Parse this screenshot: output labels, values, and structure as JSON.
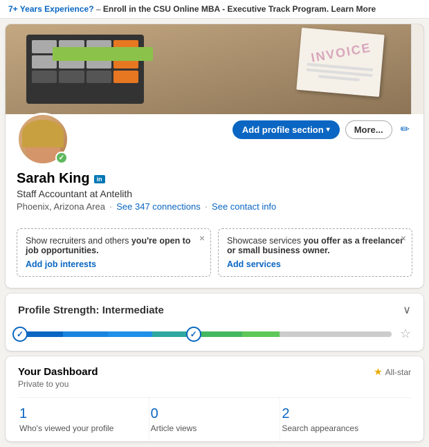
{
  "topBanner": {
    "highlight": "7+ Years Experience?",
    "dash": " – ",
    "boldText": "Enroll in the CSU Online MBA - Executive Track Program. Learn More"
  },
  "profile": {
    "name": "Sarah King",
    "linkedinBadge": "in",
    "title": "Staff Accountant at Antelith",
    "location": "Phoenix, Arizona Area",
    "connections": "See 347 connections",
    "contactInfo": "See contact info"
  },
  "actions": {
    "addSection": "Add profile section",
    "more": "More...",
    "editIcon": "✏"
  },
  "notifications": [
    {
      "id": "n1",
      "normalText": "Show recruiters and others ",
      "boldText": "you're open to job opportunities.",
      "linkText": "Add job interests"
    },
    {
      "id": "n2",
      "normalText": "Showcase services ",
      "boldText": "you offer as a freelancer or small business owner.",
      "linkText": "Add services"
    }
  ],
  "profileStrength": {
    "label": "Profile Strength:",
    "level": "Intermediate",
    "chevron": "∨"
  },
  "dashboard": {
    "title": "Your Dashboard",
    "subtitle": "Private to you",
    "allstarLabel": "All-star",
    "stats": [
      {
        "number": "1",
        "label": "Who's viewed your profile"
      },
      {
        "number": "0",
        "label": "Article views"
      },
      {
        "number": "2",
        "label": "Search appearances"
      }
    ]
  }
}
